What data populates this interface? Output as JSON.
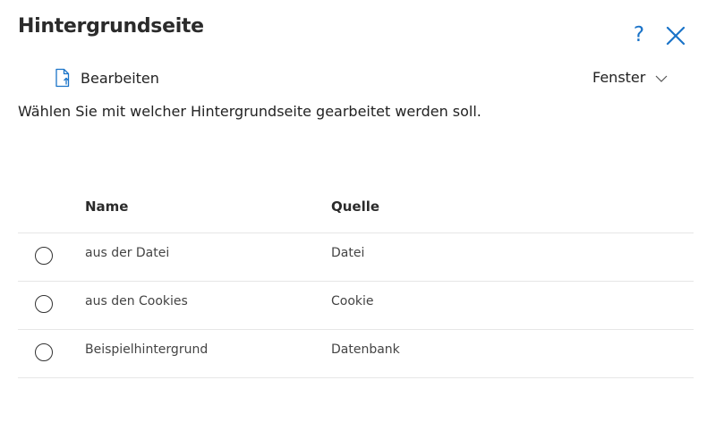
{
  "dialog": {
    "title": "Hintergrundseite",
    "help_icon": "question-icon",
    "close_icon": "close-icon"
  },
  "toolbar": {
    "edit_label": "Bearbeiten",
    "edit_icon": "document-upload-icon",
    "window_label": "Fenster",
    "window_icon": "chevron-down-icon"
  },
  "instruction": "Wählen Sie mit welcher Hintergrundseite gearbeitet werden soll.",
  "table": {
    "headers": [
      "Name",
      "Quelle"
    ],
    "rows": [
      {
        "name": "aus der Datei",
        "source": "Datei"
      },
      {
        "name": "aus den Cookies",
        "source": "Cookie"
      },
      {
        "name": "Beispielhintergrund",
        "source": "Datenbank"
      }
    ]
  },
  "colors": {
    "accent": "#1a73c8",
    "text": "#222222",
    "divider": "#e6e6e6"
  }
}
